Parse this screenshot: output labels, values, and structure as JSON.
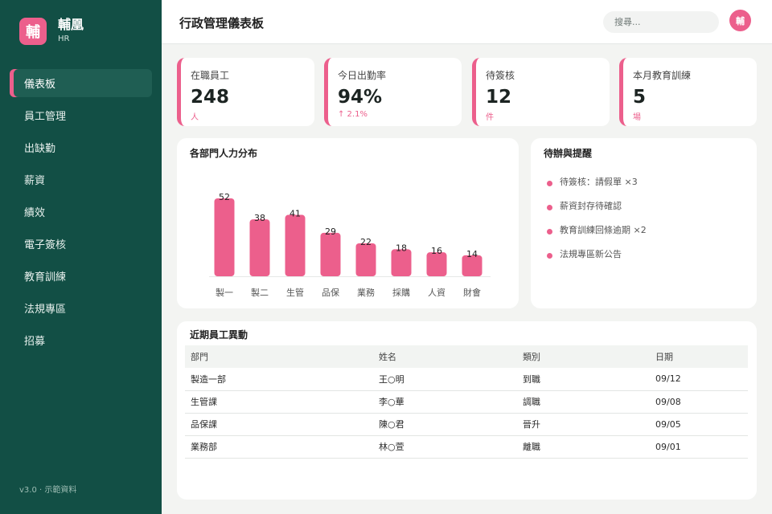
{
  "brand": {
    "logo_char": "輔",
    "name": "輔凰",
    "sub": "HR"
  },
  "sidebar": {
    "items": [
      {
        "label": "儀表板",
        "active": true
      },
      {
        "label": "員工管理"
      },
      {
        "label": "出缺勤"
      },
      {
        "label": "薪資"
      },
      {
        "label": "績效"
      },
      {
        "label": "電子簽核"
      },
      {
        "label": "教育訓練"
      },
      {
        "label": "法規專區"
      },
      {
        "label": "招募"
      }
    ],
    "footer": "v3.0 · 示範資料"
  },
  "header": {
    "title": "行政管理儀表板",
    "search_placeholder": "搜尋...",
    "avatar_char": "輔"
  },
  "stats": [
    {
      "label": "在職員工",
      "value": "248",
      "unit": "人"
    },
    {
      "label": "今日出勤率",
      "value": "94%",
      "unit": "↑ 2.1%"
    },
    {
      "label": "待簽核",
      "value": "12",
      "unit": "件"
    },
    {
      "label": "本月教育訓練",
      "value": "5",
      "unit": "場"
    }
  ],
  "colors": {
    "accent": "#ec5f8c",
    "sidebar": "#124f45",
    "background": "#f3f4f2"
  },
  "chart": {
    "title": "各部門人力分布"
  },
  "chart_data": {
    "type": "bar",
    "categories": [
      "製一",
      "製二",
      "生管",
      "品保",
      "業務",
      "採購",
      "人資",
      "財會"
    ],
    "values": [
      52,
      38,
      41,
      29,
      22,
      18,
      16,
      14
    ],
    "title": "各部門人力分布",
    "ylim": [
      0,
      52
    ],
    "grid": false
  },
  "todos": {
    "title": "待辦與提醒",
    "items": [
      "待簽核：請假單 ×3",
      "薪資封存待確認",
      "教育訓練回條逾期 ×2",
      "法規專區新公告"
    ]
  },
  "changes": {
    "title": "近期員工異動",
    "columns": [
      "部門",
      "姓名",
      "類別",
      "日期"
    ],
    "rows": [
      [
        "製造一部",
        "王○明",
        "到職",
        "09/12"
      ],
      [
        "生管課",
        "李○華",
        "調職",
        "09/08"
      ],
      [
        "品保課",
        "陳○君",
        "晉升",
        "09/05"
      ],
      [
        "業務部",
        "林○萱",
        "離職",
        "09/01"
      ]
    ]
  }
}
